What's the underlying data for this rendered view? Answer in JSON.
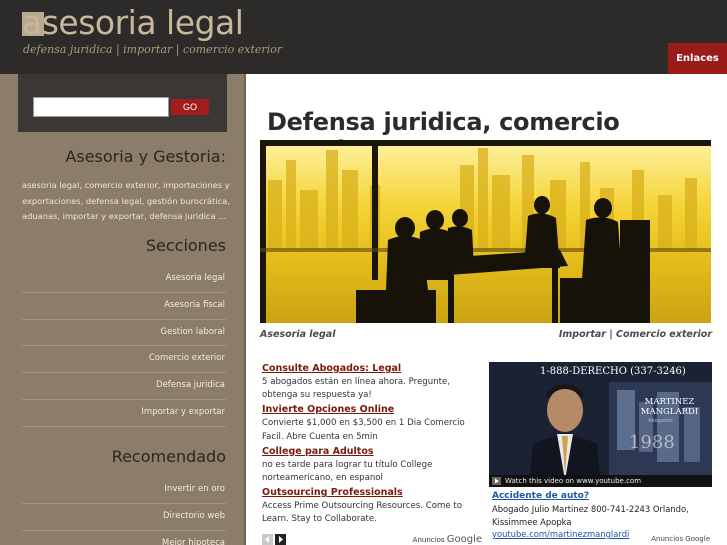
{
  "header": {
    "logo_text": "asesoria legal",
    "tagline": "defensa juridica | importar | comercio exterior",
    "enlaces_label": "Enlaces"
  },
  "sidebar": {
    "search": {
      "value": "",
      "placeholder": "",
      "go_label": "GO"
    },
    "about_title": "Asesoria y Gestoria:",
    "about_text": "asesoria legal, comercio exterior, importaciones y exportaciones, defensa legal, gestión burocrática, aduanas, importar y exportar, defensa juridica ...",
    "sections_title": "Secciones",
    "sections": [
      "Asesoria legal",
      "Asesoria fiscal",
      "Gestion laboral",
      "Comercio exterior",
      "Defensa juridica",
      "Importar y exportar"
    ],
    "recommended_title": "Recomendado",
    "recommended": [
      "Invertir en oro",
      "Directorio web",
      "Mejor hipoteca"
    ]
  },
  "main": {
    "title": "Defensa juridica, comercio exterior",
    "caption_left": "Asesoria legal",
    "caption_right": "Importar | Comercio exterior",
    "ads": [
      {
        "title": "Consulte Abogados: Legal",
        "text": "5 abogados están en línea ahora. Pregunte, obtenga su respuesta ya!"
      },
      {
        "title": "Invierte Opciones Online",
        "text": "Convierte $1,000 en $3,500 en 1 Dia Comercio Facil. Abre Cuenta en 5min"
      },
      {
        "title": "College para Adultos",
        "text": "no es tarde para lograr tu título College norteamericano, en espanol"
      },
      {
        "title": "Outsourcing Professionals",
        "text": "Access Prime Outsourcing Resources. Come to Learn. Stay to Collaborate."
      }
    ],
    "ads_by": "Anuncios",
    "ads_by_brand": "Google",
    "video_ad": {
      "phone": "1-888-DERECHO (337-3246)",
      "brand": "MARTINEZ MANGLARDI",
      "brand_sub": "Abogados",
      "year": "1988",
      "watch_label": "Watch this video on www.youtube.com",
      "title": "Accidente de auto?",
      "text": "Abogado Julio Martinez 800-741-2243 Orlando, Kissimmee Apopka",
      "url": "youtube.com/martinezmanglardi",
      "ads_by": "Anuncios Google"
    }
  },
  "colors": {
    "header_bg": "#2d2b29",
    "sidebar_bg": "#8c7c6a",
    "accent_red": "#9b1a1a",
    "ad_title": "#7a1a0c",
    "video_link": "#1f57a8"
  }
}
